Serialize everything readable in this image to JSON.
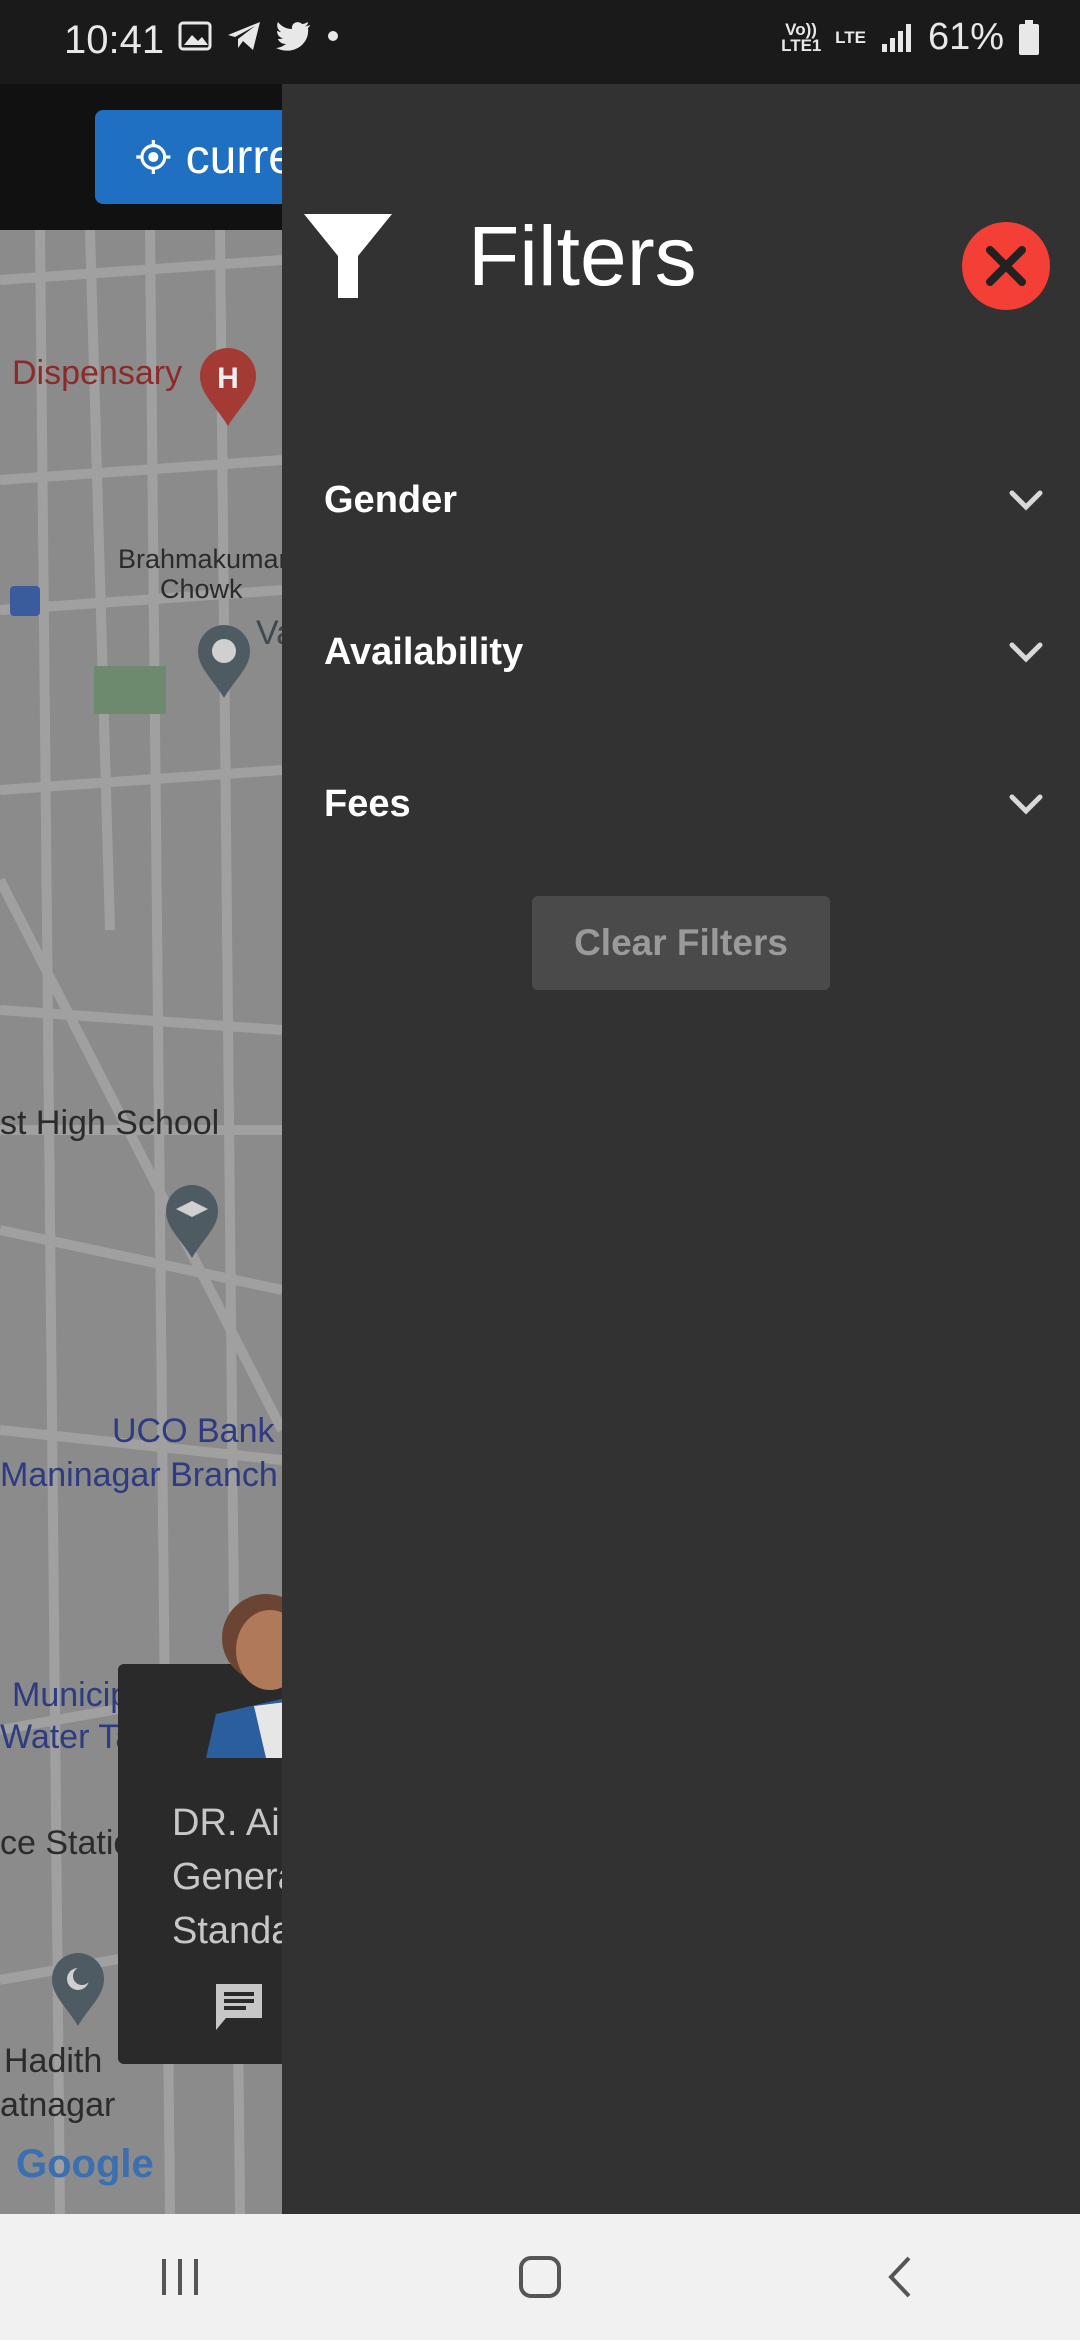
{
  "status_bar": {
    "time": "10:41",
    "network_label_top": "Vo)) LTE1",
    "network_label_lte": "LTE",
    "battery_percent": "61%",
    "icons": [
      "gallery-icon",
      "telegram-icon",
      "twitter-icon",
      "dot-icon",
      "signal-icon",
      "battery-icon"
    ]
  },
  "map": {
    "location_button_label": "curre",
    "labels": {
      "dispensary": "Dispensary",
      "chowk_line1": "Brahmakumari",
      "chowk_line2": "Chowk",
      "va": "Va",
      "school": "st High School",
      "bank_line1": "UCO Bank",
      "bank_line2": "Maninagar Branch",
      "municipal_line1": "Municip",
      "municipal_line2": "Water Ta",
      "station": "ce Statio",
      "hadith": "Hadith",
      "nagar": "atnagar",
      "google": "Google"
    },
    "doctor_card": {
      "name": "DR. Ai",
      "line2": "Genera",
      "line3": "Standa"
    }
  },
  "drawer": {
    "title": "Filters",
    "filters": [
      {
        "label": "Gender"
      },
      {
        "label": "Availability"
      },
      {
        "label": "Fees"
      }
    ],
    "clear_button_label": "Clear Filters"
  },
  "colors": {
    "drawer_bg": "#323232",
    "close_button": "#f33f36",
    "map_dimmed": "#8b8b8b",
    "location_button": "#1f6fc2"
  }
}
